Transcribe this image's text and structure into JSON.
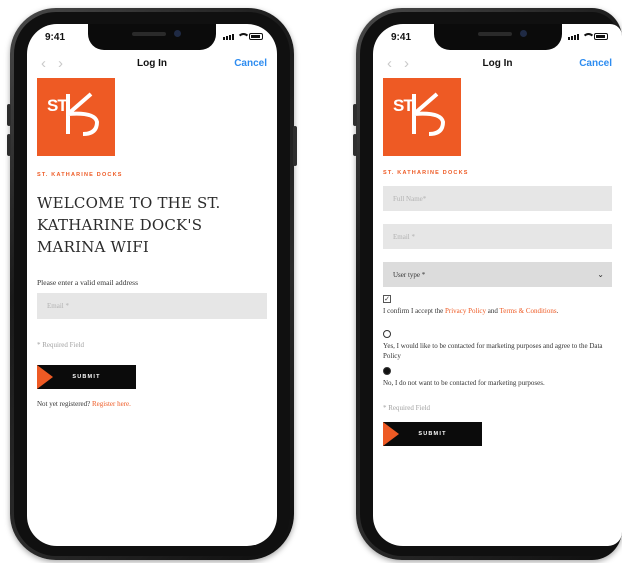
{
  "left": {
    "status_time": "9:41",
    "nav_title": "Log In",
    "cancel": "Cancel",
    "brand": "ST. KATHARINE DOCKS",
    "welcome_lines": [
      "WELCOME TO THE ST.",
      "KATHARINE DOCK'S",
      "MARINA WIFI"
    ],
    "email_label": "Please enter a valid email address",
    "email_placeholder": "Email *",
    "required_note": "* Required Field",
    "submit": "SUBMIT",
    "not_registered": "Not yet registered?",
    "register_link": "Register here."
  },
  "right": {
    "status_time": "9:41",
    "nav_title": "Log In",
    "cancel": "Cancel",
    "brand": "ST. KATHARINE DOCKS",
    "full_name_placeholder": "Full Name*",
    "email_placeholder": "Email *",
    "user_type_value": "User type *",
    "terms_prefix": "I confirm I accept the",
    "privacy_link": "Privacy Policy",
    "and_text": "and",
    "terms_link": "Terms & Conditions",
    "terms_suffix": ".",
    "terms_checked": true,
    "option_yes": "Yes, I would like to be contacted for marketing purposes and agree to the Data Policy",
    "option_no": "No, I do not want to be contacted for marketing purposes.",
    "selected_option": "no",
    "required_note": "* Required Field",
    "submit": "SUBMIT"
  },
  "icons": {
    "back": "chevron-left-icon",
    "forward": "chevron-right-icon",
    "chevron_down": "chevron-down-icon",
    "checkmark": "✓"
  },
  "colors": {
    "brand_orange": "#ee5a24",
    "ios_blue": "#2d8cf0",
    "field_bg": "#e6e6e6",
    "button_bg": "#0b0b0b"
  }
}
